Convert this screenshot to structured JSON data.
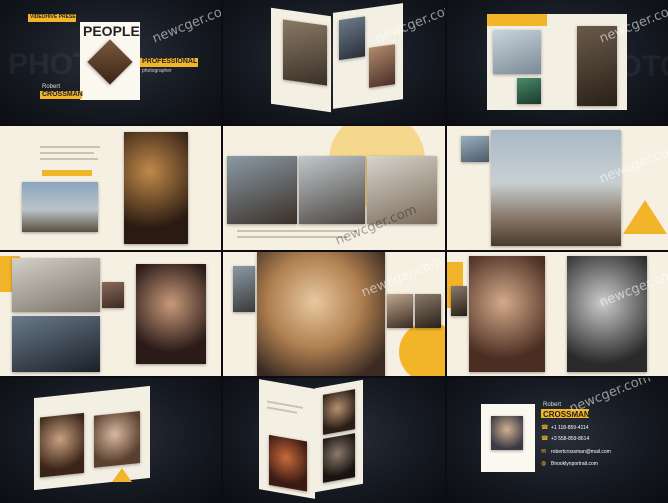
{
  "watermark": "newcger.com",
  "background_word": "PHOTO",
  "cover": {
    "presenter": "VIDEOHIVE PRESENT",
    "title": "PEOPLE",
    "role1": "PROFESSIONAL",
    "role2": "photographer",
    "first_name": "Robert",
    "last_name": "CROSSMAN"
  },
  "contact": {
    "first_name": "Robert",
    "last_name": "CROSSMAN",
    "phone1": "+1 118-859-4114",
    "phone2": "+3 558-859-8614",
    "email": "robertcrossman@mail.com",
    "website": "Bnooklynportrait.com"
  },
  "colors": {
    "accent": "#f2b52a",
    "dark_bg": "#161a22",
    "page": "#f6f0e2"
  }
}
